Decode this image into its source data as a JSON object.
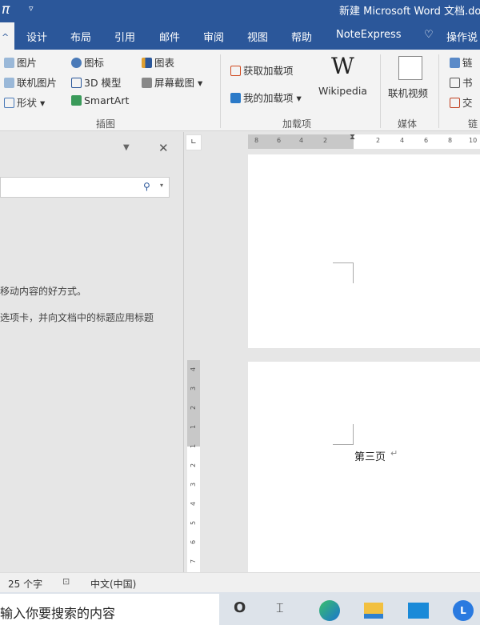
{
  "title": {
    "app_icon": "π",
    "doc_title": "新建 Microsoft Word 文档.do"
  },
  "tabs": [
    "设计",
    "布局",
    "引用",
    "邮件",
    "审阅",
    "视图",
    "帮助",
    "NoteExpress"
  ],
  "tell_me": "操作说",
  "ribbon": {
    "illustrations": {
      "items": [
        "图片",
        "联机图片",
        "形状",
        "图标",
        "3D 模型",
        "SmartArt",
        "图表",
        "屏幕截图"
      ],
      "label": "插图"
    },
    "addins": {
      "get": "获取加载项",
      "my": "我的加载项",
      "wiki": "Wikipedia",
      "label": "加载项"
    },
    "media": {
      "video": "联机视频",
      "label": "媒体"
    },
    "links": {
      "items": [
        "链",
        "书",
        "交"
      ],
      "label": "链"
    }
  },
  "nav": {
    "text1": "移动内容的好方式。",
    "text2": "选项卡，并向文档中的标题应用标题"
  },
  "ruler": {
    "h": [
      "8",
      "6",
      "4",
      "2",
      "2",
      "4",
      "6",
      "8",
      "10"
    ],
    "v": [
      "4",
      "3",
      "2",
      "1",
      "1",
      "2",
      "3",
      "4",
      "5",
      "6",
      "7"
    ]
  },
  "document": {
    "page_text": "第三页"
  },
  "status": {
    "words": "25 个字",
    "language": "中文(中国)"
  },
  "taskbar": {
    "search_placeholder": "输入你要搜索的内容"
  }
}
